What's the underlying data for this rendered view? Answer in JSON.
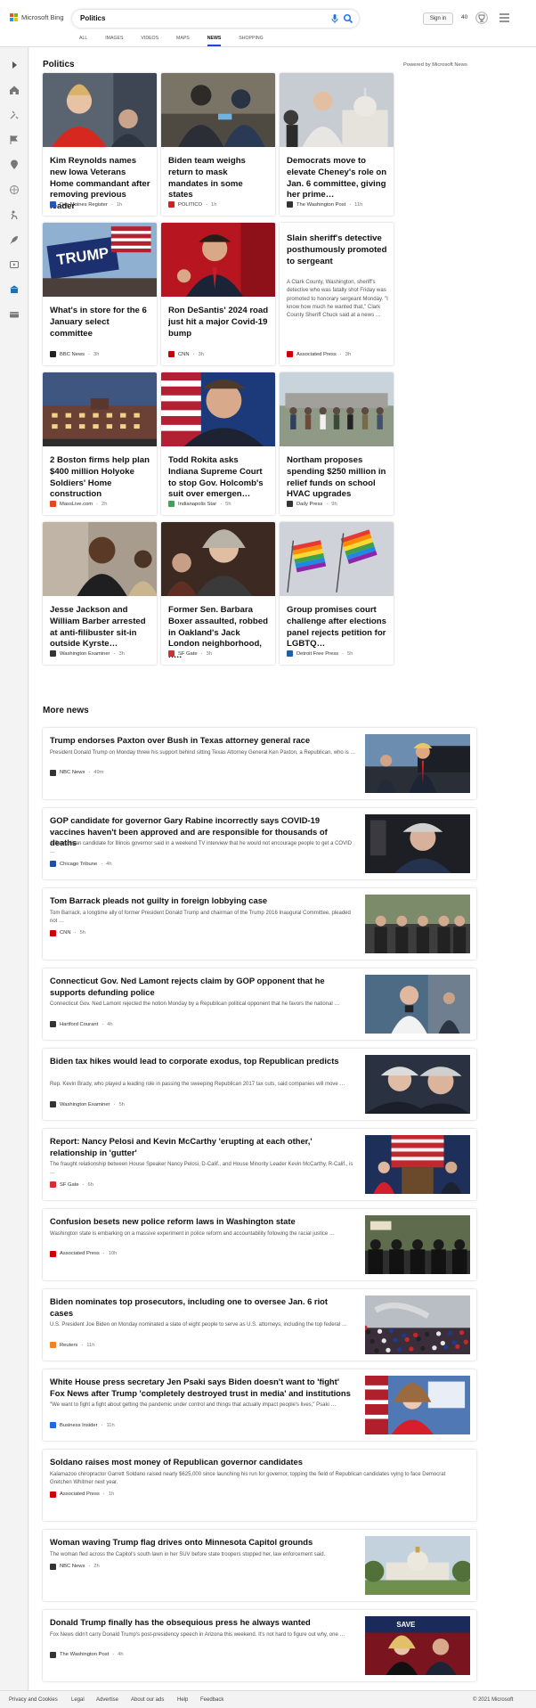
{
  "brand": {
    "name": "Microsoft Bing",
    "colors": [
      "#f25022",
      "#7fba00",
      "#00a4ef",
      "#ffb900"
    ]
  },
  "search": {
    "query": "Politics"
  },
  "header": {
    "sign_in": "Sign in",
    "points": "40"
  },
  "tabs": [
    {
      "label": "ALL",
      "active": false
    },
    {
      "label": "IMAGES",
      "active": false
    },
    {
      "label": "VIDEOS",
      "active": false
    },
    {
      "label": "MAPS",
      "active": false
    },
    {
      "label": "NEWS",
      "active": true
    },
    {
      "label": "SHOPPING",
      "active": false
    }
  ],
  "rail_icons": [
    "chevron-right-icon",
    "home-icon",
    "tools-icon",
    "flag-icon",
    "location-icon",
    "globe-icon",
    "sports-icon",
    "rocket-icon",
    "video-icon",
    "bank-icon",
    "card-icon"
  ],
  "section": {
    "title": "Politics",
    "powered_by": "Powered by Microsoft News"
  },
  "cards": [
    {
      "title": "Kim Reynolds names new Iowa Veterans Home commandant after removing previous leader",
      "source": "Des Moines Register",
      "ago": "1h",
      "fav_color": "#2456b4",
      "img": "woman-red"
    },
    {
      "title": "Biden team weighs return to mask mandates in some states",
      "source": "POLITICO",
      "ago": "1h",
      "fav_color": "#d61f1f",
      "img": "nurse"
    },
    {
      "title": "Democrats move to elevate Cheney's role on Jan. 6 committee, giving her prime…",
      "source": "The Washington Post",
      "ago": "11h",
      "fav_color": "#333333",
      "img": "capitol"
    },
    {
      "title": "What's in store for the 6 January select committee",
      "source": "BBC News",
      "ago": "3h",
      "fav_color": "#222222",
      "img": "trump-flags"
    },
    {
      "title": "Ron DeSantis' 2024 road just hit a major Covid-19 bump",
      "source": "CNN",
      "ago": "3h",
      "fav_color": "#cc0000",
      "img": "desantis"
    },
    {
      "title": "Slain sheriff's detective posthumously promoted to sergeant",
      "desc": "A Clark County, Washington, sheriff's detective who was fatally shot Friday was promoted to honorary sergeant Monday. \"I know how much he wanted that,\" Clark County Sheriff Chuck said at a news …",
      "source": "Associated Press",
      "ago": "3h",
      "fav_color": "#cc0000",
      "img": ""
    },
    {
      "title": "2 Boston firms help plan $400 million Holyoke Soldiers' Home construction",
      "source": "MassLive.com",
      "ago": "2h",
      "fav_color": "#e8461b",
      "img": "building"
    },
    {
      "title": "Todd Rokita asks Indiana Supreme Court to stop Gov. Holcomb's suit over emergen…",
      "source": "Indianapolis Star",
      "ago": "5h",
      "fav_color": "#3aa655",
      "img": "man-flag"
    },
    {
      "title": "Northam proposes spending $250 million in relief funds on school HVAC upgrades",
      "source": "Daily Press",
      "ago": "9h",
      "fav_color": "#333333",
      "img": "crowd"
    },
    {
      "title": "Jesse Jackson and William Barber arrested at anti-filibuster sit-in outside Kyrste…",
      "source": "Washington Examiner",
      "ago": "3h",
      "fav_color": "#333333",
      "img": "jackson"
    },
    {
      "title": "Former Sen. Barbara Boxer assaulted, robbed in Oakland's Jack London neighborhood, h…",
      "source": "SF Gate",
      "ago": "3h",
      "fav_color": "#d32f2f",
      "img": "boxer"
    },
    {
      "title": "Group promises court challenge after elections panel rejects petition for LGBTQ…",
      "source": "Detroit Free Press",
      "ago": "5h",
      "fav_color": "#1f5fa8",
      "img": "rainbow"
    }
  ],
  "more_news": {
    "title": "More news",
    "items": [
      {
        "title": "Trump endorses Paxton over Bush in Texas attorney general race",
        "desc": "President Donald Trump on Monday threw his support behind sitting Texas Attorney General Ken Paxton, a Republican, who is …",
        "source": "NBC News",
        "ago": "49m",
        "fav_color": "#333333",
        "img": "trump"
      },
      {
        "title": "GOP candidate for governor Gary Rabine incorrectly says COVID-19 vaccines haven't been approved and are responsible for thousands of deaths",
        "desc": "A Republican candidate for Illinois governor said in a weekend TV interview that he would not encourage people to get a COVID …",
        "source": "Chicago Tribune",
        "ago": "4h",
        "fav_color": "#1f4fa3",
        "img": "rabine"
      },
      {
        "title": "Tom Barrack pleads not guilty in foreign lobbying case",
        "desc": "Tom Barrack, a longtime ally of former President Donald Trump and chairman of the Trump 2016 Inaugural Committee, pleaded not …",
        "source": "CNN",
        "ago": "5h",
        "fav_color": "#cc0000",
        "img": "barrack"
      },
      {
        "title": "Connecticut Gov. Ned Lamont rejects claim by GOP opponent that he supports defunding police",
        "desc": "Connecticut Gov. Ned Lamont rejected the notion Monday by a Republican political opponent that he favors the national …",
        "source": "Hartford Courant",
        "ago": "4h",
        "fav_color": "#333333",
        "img": "lamont"
      },
      {
        "title": "Biden tax hikes would lead to corporate exodus, top Republican predicts",
        "desc": "Rep. Kevin Brady, who played a leading role in passing the sweeping Republican 2017 tax cuts, said companies will move …",
        "source": "Washington Examiner",
        "ago": "5h",
        "fav_color": "#333333",
        "img": "brady"
      },
      {
        "title": "Report: Nancy Pelosi and Kevin McCarthy 'erupting at each other,' relationship in 'gutter'",
        "desc": "The fraught relationship between House Speaker Nancy Pelosi, D-Calif., and House Minority Leader Kevin McCarthy, R-Calif., is …",
        "source": "SF Gate",
        "ago": "6h",
        "fav_color": "#d32f2f",
        "img": "pelosi"
      },
      {
        "title": "Confusion besets new police reform laws in Washington state",
        "desc": "Washington state is embarking on a massive experiment in police reform and accountability following the racial justice …",
        "source": "Associated Press",
        "ago": "10h",
        "fav_color": "#cc0000",
        "img": "police"
      },
      {
        "title": "Biden nominates top prosecutors, including one to oversee Jan. 6 riot cases",
        "desc": "U.S. President Joe Biden on Monday nominated a slate of eight people to serve as U.S. attorneys, including the top federal …",
        "source": "Reuters",
        "ago": "11h",
        "fav_color": "#f58220",
        "img": "riot"
      },
      {
        "title": "White House press secretary Jen Psaki says Biden doesn't want to 'fight' Fox News after Trump 'completely destroyed trust in media' and institutions",
        "desc": "\"We want to fight a fight about getting the pandemic under control and things that actually impact people's lives,\" Psaki …",
        "source": "Business Insider",
        "ago": "11h",
        "fav_color": "#1b6ae0",
        "img": "psaki"
      },
      {
        "title": "Soldano raises most money of Republican governor candidates",
        "desc": "Kalamazoo chiropractor Garrett Soldano raised nearly $625,000 since launching his run for governor, topping the field of Republican candidates vying to face Democrat Gretchen Whitmer next year.",
        "source": "Associated Press",
        "ago": "1h",
        "fav_color": "#cc0000",
        "img": ""
      },
      {
        "title": "Woman waving Trump flag drives onto Minnesota Capitol grounds",
        "desc": "The woman fled across the Capitol's south lawn in her SUV before state troopers stopped her, law enforcement said.",
        "source": "NBC News",
        "ago": "2h",
        "fav_color": "#333333",
        "img": "mncapitol"
      },
      {
        "title": "Donald Trump finally has the obsequious press he always wanted",
        "desc": "Fox News didn't carry Donald Trump's post-presidency speech in Arizona this weekend. It's not hard to figure out why, one …",
        "source": "The Washington Post",
        "ago": "4h",
        "fav_color": "#333333",
        "img": "trumppress"
      }
    ]
  },
  "footer": {
    "links": [
      "Privacy and Cookies",
      "Legal",
      "Advertise",
      "About our ads",
      "Help",
      "Feedback"
    ],
    "copyright": "© 2021 Microsoft"
  }
}
